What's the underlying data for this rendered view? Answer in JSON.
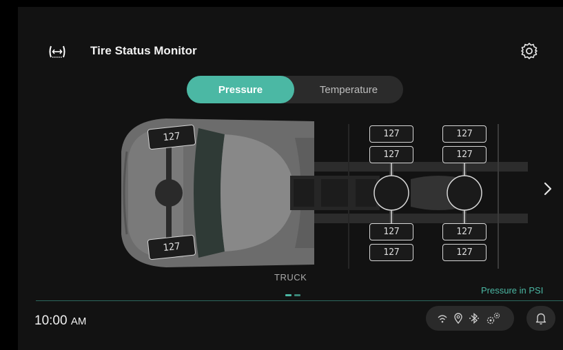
{
  "header": {
    "title": "Tire Status Monitor",
    "tpms_icon": "tpms-icon",
    "settings_icon": "gear-icon"
  },
  "tabs": [
    {
      "label": "Pressure",
      "active": true
    },
    {
      "label": "Temperature",
      "active": false
    }
  ],
  "vehicle": {
    "label": "TRUCK",
    "front": {
      "left": "127",
      "right": "127"
    },
    "rear_axle_1": {
      "left_outer": "127",
      "left_inner": "127",
      "right_inner": "127",
      "right_outer": "127"
    },
    "rear_axle_2": {
      "left_outer": "127",
      "left_inner": "127",
      "right_inner": "127",
      "right_outer": "127"
    }
  },
  "unit_note": "Pressure in PSI",
  "page_indicator": {
    "pages": 2,
    "current": 1
  },
  "status_bar": {
    "time": "10:00",
    "ampm": "AM",
    "icons": [
      "wifi-icon",
      "location-icon",
      "bluetooth-icon",
      "gears-icon"
    ],
    "notification_icon": "bell-icon"
  },
  "colors": {
    "accent": "#4bb8a4",
    "background": "#121212",
    "tile_border": "#d8d8d8"
  }
}
